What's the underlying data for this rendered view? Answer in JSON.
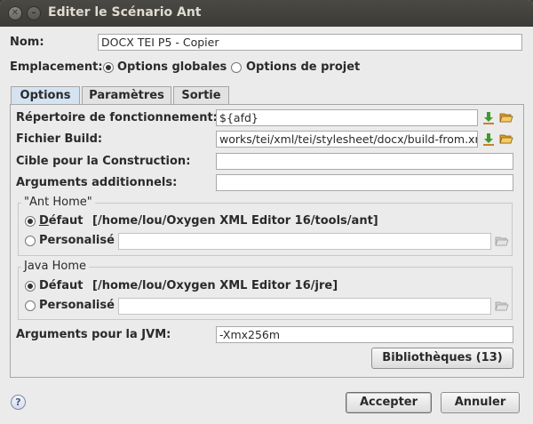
{
  "window": {
    "title": "Editer le Scénario Ant",
    "close_glyph": "✕",
    "minimize_glyph": "–"
  },
  "name_row": {
    "label": "Nom:",
    "value": "DOCX TEI P5 - Copier"
  },
  "location": {
    "label": "Emplacement:",
    "options": [
      {
        "label": "Options globales",
        "selected": true
      },
      {
        "label": "Options de projet",
        "selected": false
      }
    ]
  },
  "tabs": [
    {
      "label": "Options",
      "active": true
    },
    {
      "label": "Paramètres",
      "active": false
    },
    {
      "label": "Sortie",
      "active": false
    }
  ],
  "options": {
    "working_dir": {
      "label": "Répertoire de fonctionnement:",
      "value": "${afd}"
    },
    "build_file": {
      "label": "Fichier Build:",
      "value": "works/tei/xml/tei/stylesheet/docx/build-from.xml"
    },
    "build_target": {
      "label": "Cible pour la Construction:",
      "value": ""
    },
    "extra_args": {
      "label": "Arguments additionnels:",
      "value": ""
    },
    "ant_home": {
      "title": "\"Ant Home\"",
      "default_label": "Défaut",
      "default_path": "[/home/lou/Oxygen XML Editor 16/tools/ant]",
      "custom_label": "Personalisé",
      "custom_value": "",
      "selected": "default"
    },
    "java_home": {
      "title": "Java Home",
      "default_label": "Défaut",
      "default_path": "[/home/lou/Oxygen XML Editor 16/jre]",
      "custom_label": "Personalisé",
      "custom_value": "",
      "selected": "default"
    },
    "jvm_args": {
      "label": "Arguments pour la JVM:",
      "value": "-Xmx256m"
    },
    "libraries_button": "Bibliothèques (13)"
  },
  "footer": {
    "help_glyph": "?",
    "accept_label": "Accepter",
    "cancel_label": "Annuler"
  },
  "colors": {
    "titlebar": "#3c3b37",
    "active_tab": "#d5e2f2",
    "download_icon": "#3a9a2a",
    "folder_icon": "#e7b84a"
  }
}
